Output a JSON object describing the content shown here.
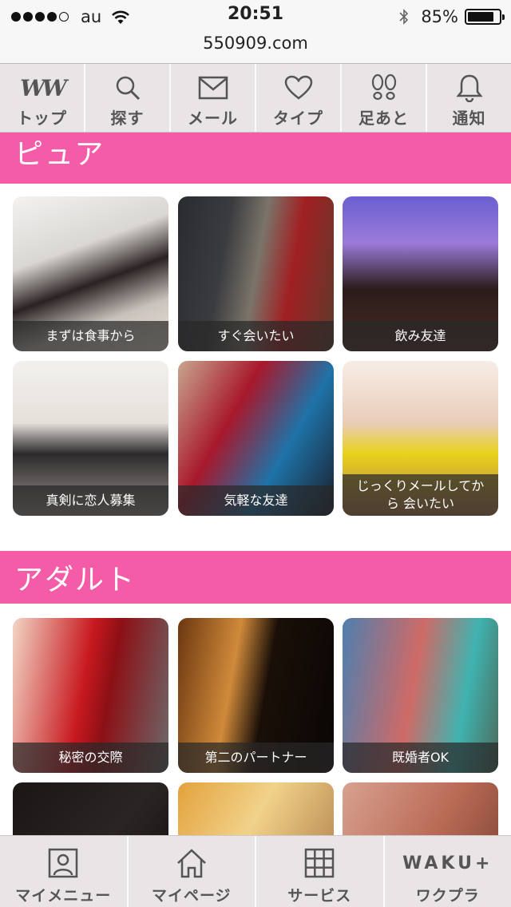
{
  "status_bar": {
    "carrier": "au",
    "signal_bars": 4,
    "signal_total": 5,
    "time": "20:51",
    "battery_percent": "85%",
    "battery_level": 0.85,
    "url": "550909.com"
  },
  "top_nav": {
    "items": [
      {
        "label": "トップ",
        "icon": "ww-logo-icon",
        "logo_text": "WW"
      },
      {
        "label": "探す",
        "icon": "search-icon"
      },
      {
        "label": "メール",
        "icon": "mail-icon"
      },
      {
        "label": "タイプ",
        "icon": "heart-icon"
      },
      {
        "label": "足あと",
        "icon": "footprints-icon"
      },
      {
        "label": "通知",
        "icon": "bell-icon"
      }
    ]
  },
  "sections": {
    "pure": {
      "title": "ピュア",
      "cards": [
        {
          "caption": "まずは食事から"
        },
        {
          "caption": "すぐ会いたい"
        },
        {
          "caption": "飲み友達"
        },
        {
          "caption": "真剣に恋人募集"
        },
        {
          "caption": "気軽な友達"
        },
        {
          "caption": "じっくりメールしてから 会いたい"
        }
      ]
    },
    "adult": {
      "title": "アダルト",
      "cards": [
        {
          "caption": "秘密の交際"
        },
        {
          "caption": "第二のパートナー"
        },
        {
          "caption": "既婚者OK"
        }
      ]
    }
  },
  "bottom_nav": {
    "items": [
      {
        "label": "マイメニュー",
        "icon": "profile-icon"
      },
      {
        "label": "マイページ",
        "icon": "home-icon"
      },
      {
        "label": "サービス",
        "icon": "grid-icon"
      },
      {
        "label": "ワクプラ",
        "icon": "waku-plus-logo-icon",
        "logo_text": "WAKU+"
      }
    ]
  },
  "colors": {
    "accent_pink": "#f55ca8",
    "nav_background": "#e9e4e6"
  }
}
